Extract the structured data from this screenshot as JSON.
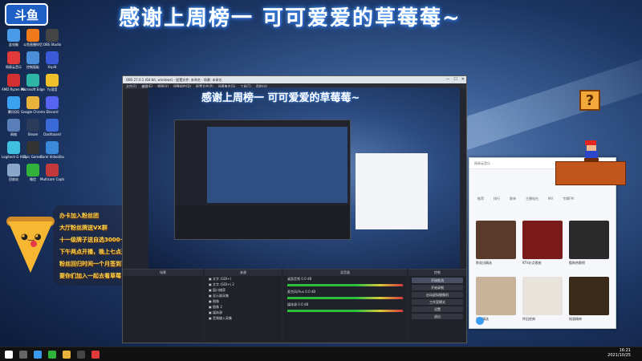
{
  "banner": {
    "text": "感谢上周榜一 可可爱爱的草莓莓~"
  },
  "logo": {
    "text": "斗鱼"
  },
  "desktop_icons": [
    {
      "label": "此电脑",
      "color": "#4a9be8"
    },
    {
      "label": "网易云音乐",
      "color": "#e23a3a"
    },
    {
      "label": "AMD Ryzen Master",
      "color": "#d23030"
    },
    {
      "label": "腾讯QQ",
      "color": "#3aa0f0"
    },
    {
      "label": "网络",
      "color": "#5a7fb8"
    },
    {
      "label": "Logitech G HUB",
      "color": "#40c0e0"
    },
    {
      "label": "回收站",
      "color": "#8aa6c8"
    },
    {
      "label": "斗鱼直播伴侣",
      "color": "#f07a1a"
    },
    {
      "label": "控制面板",
      "color": "#4c8ed8"
    },
    {
      "label": "Microsoft Edge",
      "color": "#2fb5a5"
    },
    {
      "label": "Google Chrome",
      "color": "#e9b23a"
    },
    {
      "label": "Steam",
      "color": "#2a3c5a"
    },
    {
      "label": "Epic Games",
      "color": "#333333"
    },
    {
      "label": "微信",
      "color": "#31b23a"
    },
    {
      "label": "OBS Studio",
      "color": "#444444"
    },
    {
      "label": "Xsplit",
      "color": "#3a5ad8"
    },
    {
      "label": "Yy语音",
      "color": "#f0c02a"
    },
    {
      "label": "Discord",
      "color": "#5865f2"
    },
    {
      "label": "Dashboard",
      "color": "#3a6ad8"
    },
    {
      "label": "Corel VideoStudio",
      "color": "#3a8ad8"
    },
    {
      "label": "Multicam Capture",
      "color": "#c43a3a"
    }
  ],
  "obs": {
    "title": "OBS 27.0.1 (64-bit, windows) - 配置文件: 未命名 - 场景: 未命名",
    "menu": [
      "文件(F)",
      "编辑(E)",
      "视图(V)",
      "停靠部件(D)",
      "配置文件(P)",
      "场景集合(S)",
      "工具(T)",
      "帮助(H)"
    ],
    "preview_title": "感谢上周榜一 可可爱爱的草莓莓~",
    "docks": {
      "scenes": "场景",
      "sources": "来源",
      "mixer": "混音器",
      "transitions": "转场特效",
      "controls": "控制"
    },
    "sources": [
      "文字 (GDI+)",
      "文字 (GDI+) 2",
      "窗口捕获",
      "显示器采集",
      "图像",
      "图像 2",
      "媒体源",
      "音频输入采集"
    ],
    "mixer": [
      {
        "label": "桌面音频",
        "value": "0.0 dB"
      },
      {
        "label": "麦克风/Aux",
        "value": "0.0 dB"
      },
      {
        "label": "媒体源",
        "value": "0.0 dB"
      }
    ],
    "transition": {
      "name": "淡出",
      "duration_label": "时长",
      "duration": "300 ms"
    },
    "controls": [
      "开始推流",
      "开始录制",
      "启动虚拟摄像机",
      "工作室模式",
      "设置",
      "退出"
    ],
    "status": "LIVE: 00:00:00  REC: 00:00:00  CPU: 1.2%, 30.00 fps"
  },
  "music": {
    "header": "网易云音乐",
    "tabs": [
      "推荐",
      "排行",
      "歌单",
      "主播电台",
      "MV",
      "专属FM"
    ],
    "albums": [
      {
        "title": "陈奕迅精选",
        "color": "#5a3a2a"
      },
      {
        "title": "KTV必点歌曲",
        "color": "#7a1a1a"
      },
      {
        "title": "酷狗热歌榜",
        "color": "#2a2a2a"
      },
      {
        "title": "民谣精选",
        "color": "#c8b39a"
      },
      {
        "title": "怀旧经典",
        "color": "#e8e4dc"
      },
      {
        "title": "摇滚精神",
        "color": "#3a2a1a"
      }
    ]
  },
  "overlay": {
    "lines": [
      "办卡加入粉丝团",
      "大厅粉丝牌送VX群",
      "十一级牌子送自选3000卡查等",
      "下午两点开播，晚上七点开播",
      "粉丝回归时间一个月签到可领取任务",
      "要你们加入一起去看草莓"
    ]
  },
  "taskbar": {
    "time": "16:21",
    "date": "2021/10/25"
  }
}
